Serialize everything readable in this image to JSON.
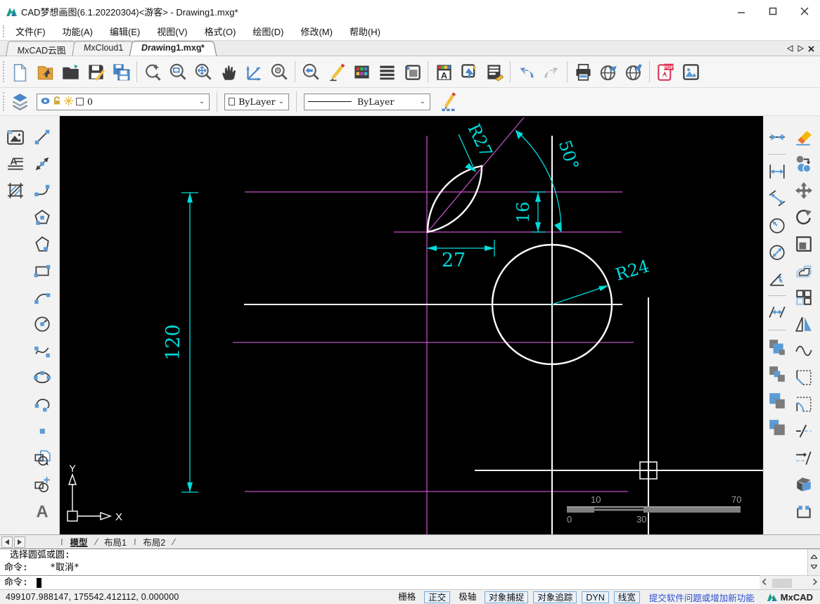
{
  "window": {
    "title": "CAD梦想画图(6.1.20220304)<游客> - Drawing1.mxg*"
  },
  "menu_bar": {
    "items": [
      "文件(F)",
      "功能(A)",
      "编辑(E)",
      "视图(V)",
      "格式(O)",
      "绘图(D)",
      "修改(M)",
      "帮助(H)"
    ]
  },
  "doc_tabs": {
    "items": [
      "MxCAD云图",
      "MxCloud1",
      "Drawing1.mxg*"
    ],
    "active": "Drawing1.mxg*"
  },
  "toolbar": {
    "icons": [
      "new-file",
      "open-cloud",
      "open-file",
      "save",
      "save-as",
      "zoom-scale",
      "zoom-window",
      "zoom-extents",
      "pan",
      "ucs-axes",
      "zoom-center",
      "zoom-previous",
      "sketch-pencil",
      "color-palette",
      "linetype-list",
      "page-setup",
      "text-style",
      "quick-select",
      "property-edit",
      "undo",
      "redo",
      "print",
      "web-publish",
      "web-open",
      "export-pdf",
      "insert-image"
    ]
  },
  "properties_bar": {
    "layer_value": "0",
    "color_value": "ByLayer",
    "linetype_value": "ByLayer"
  },
  "left_toolbar": {
    "icons": [
      "insert-image-tool",
      "text-paragraph",
      "hatch",
      "line",
      "construction-line",
      "polyline",
      "polygon",
      "polygon-irregular",
      "rectangle",
      "arc",
      "circle",
      "spline",
      "ellipse",
      "arc-continue",
      "point",
      "region",
      "region-create",
      "single-text"
    ]
  },
  "right_toolbar": {
    "icons": [
      "dim-quick",
      "dim-linear",
      "dim-aligned",
      "dim-radius",
      "dim-diameter",
      "dim-angular",
      "dim-continue",
      "draworder-above",
      "draworder-under",
      "draworder-front",
      "draworder-back",
      "erase",
      "copy",
      "move",
      "rotate",
      "scale",
      "offset",
      "array",
      "mirror",
      "revision-curve",
      "chamfer",
      "fillet",
      "break",
      "break-at-point",
      "box-3d",
      "polyline-edit"
    ],
    "brand_colors": {
      "accent": "#4a86c8",
      "dark": "#4a4a4a"
    }
  },
  "canvas": {
    "dimensions": {
      "vertical": "120",
      "horizontal": "27",
      "offset": "16",
      "angle": "50°",
      "leaf_radius": "R27",
      "circle_radius": "R24"
    },
    "ucs": {
      "x": "X",
      "y": "Y"
    },
    "ruler_ticks": [
      "0",
      "10",
      "30",
      "70"
    ],
    "colors": {
      "background": "#000000",
      "geometry": "#ffffff",
      "construction": "#bf4fbf",
      "dimension": "#00dcdc"
    }
  },
  "layout_tabs": {
    "items": [
      "模型",
      "布局1",
      "布局2"
    ],
    "active": "模型"
  },
  "command_panel": {
    "history_line1": " 选择圆弧或圆:",
    "history_line2": "命令:    *取消*",
    "prompt": "命令: "
  },
  "status_bar": {
    "coordinates": "499107.988147,  175542.412112,  0.000000",
    "toggles": [
      {
        "label": "栅格",
        "boxed": false
      },
      {
        "label": "正交",
        "boxed": true
      },
      {
        "label": "极轴",
        "boxed": false
      },
      {
        "label": "对象捕捉",
        "boxed": true
      },
      {
        "label": "对象追踪",
        "boxed": true
      },
      {
        "label": "DYN",
        "boxed": true
      },
      {
        "label": "线宽",
        "boxed": true
      }
    ],
    "feedback_link": "提交软件问题或增加新功能",
    "brand": "MxCAD"
  }
}
